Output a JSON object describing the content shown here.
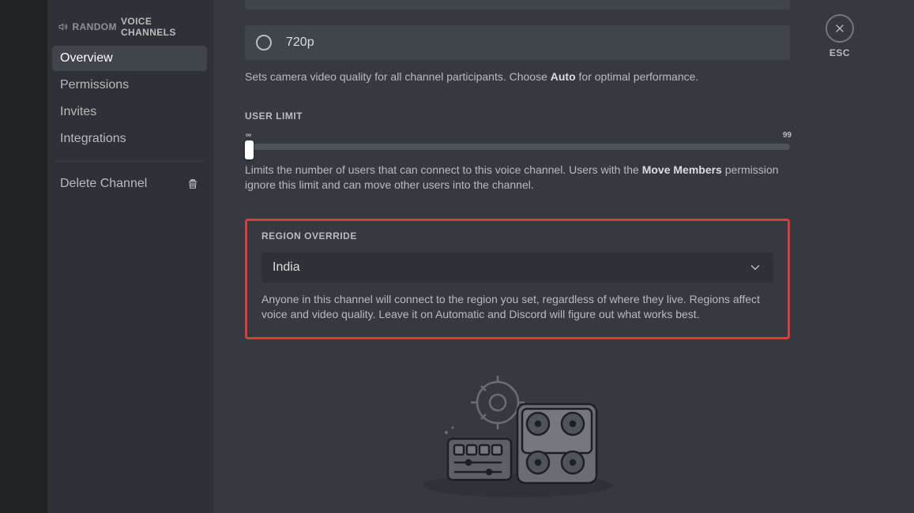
{
  "sidebar": {
    "channel": "RANDOM",
    "vc_label": "VOICE CHANNELS",
    "items": [
      "Overview",
      "Permissions",
      "Invites",
      "Integrations"
    ],
    "delete_label": "Delete Channel"
  },
  "video": {
    "option_720p": "720p",
    "help_prefix": "Sets camera video quality for all channel participants. Choose ",
    "help_bold": "Auto",
    "help_suffix": " for optimal performance."
  },
  "userLimit": {
    "title": "USER LIMIT",
    "min": "∞",
    "max": "99",
    "help_prefix": "Limits the number of users that can connect to this voice channel. Users with the ",
    "help_bold": "Move Members",
    "help_suffix": " permission ignore this limit and can move other users into the channel."
  },
  "region": {
    "title": "REGION OVERRIDE",
    "selected": "India",
    "help": "Anyone in this channel will connect to the region you set, regardless of where they live. Regions affect voice and video quality. Leave it on Automatic and Discord will figure out what works best."
  },
  "close": {
    "label": "ESC"
  }
}
